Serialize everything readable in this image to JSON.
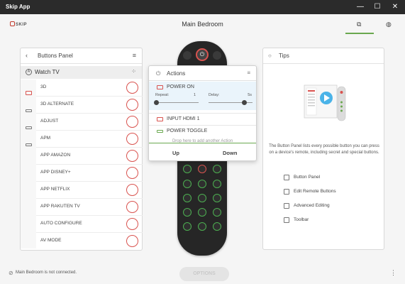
{
  "window": {
    "title": "Skip App",
    "minimize": "—",
    "maximize": "☐",
    "close": "✕"
  },
  "appbar": {
    "logo_text": "SKIP",
    "page_title": "Main Bedroom",
    "copy_icon": "copy-icon",
    "globe_icon": "globe-icon"
  },
  "buttons_panel": {
    "title": "Buttons Panel",
    "device_label": "Watch TV",
    "items": [
      {
        "label": "3D"
      },
      {
        "label": "3D ALTERNATE"
      },
      {
        "label": "ADJUST"
      },
      {
        "label": "APM"
      },
      {
        "label": "APP AMAZON"
      },
      {
        "label": "APP DISNEY+"
      },
      {
        "label": "APP NETFLIX"
      },
      {
        "label": "APP RAKUTEN TV"
      },
      {
        "label": "AUTO CONFIGURE"
      },
      {
        "label": "AV MODE"
      }
    ]
  },
  "actions": {
    "title": "Actions",
    "selected": {
      "label": "POWER ON",
      "repeat_label": "Repeat:",
      "repeat_value": "1",
      "delay_label": "Delay:",
      "delay_value": "5s",
      "repeat_fraction": 0.0,
      "delay_fraction": 0.8
    },
    "rows": [
      {
        "label": "INPUT HDMI 1",
        "icon": "tv-icon"
      },
      {
        "label": "POWER TOGGLE",
        "icon": "device-icon"
      }
    ],
    "drop_hint": "Drop here to add another Action",
    "up_label": "Up",
    "down_label": "Down"
  },
  "tips": {
    "title": "Tips",
    "description": "The Button Panel lists every possible button you can press on a device's remote, including secret and special buttons.",
    "links": [
      {
        "label": "Button Panel",
        "icon": "remote-icon"
      },
      {
        "label": "Edit Remote Buttons",
        "icon": "edit-icon"
      },
      {
        "label": "Advanced Editing",
        "icon": "advanced-icon"
      },
      {
        "label": "Toolbar",
        "icon": "toolbar-icon"
      }
    ]
  },
  "status": {
    "text": "Main Bedroom is not connected.",
    "options_label": "OPTIONS"
  },
  "colors": {
    "accent_green": "#6aa84f",
    "button_red": "#d9534f",
    "remote_body": "#262626",
    "titlebar": "#2b2b2b",
    "play_blue": "#4ab3e8"
  }
}
